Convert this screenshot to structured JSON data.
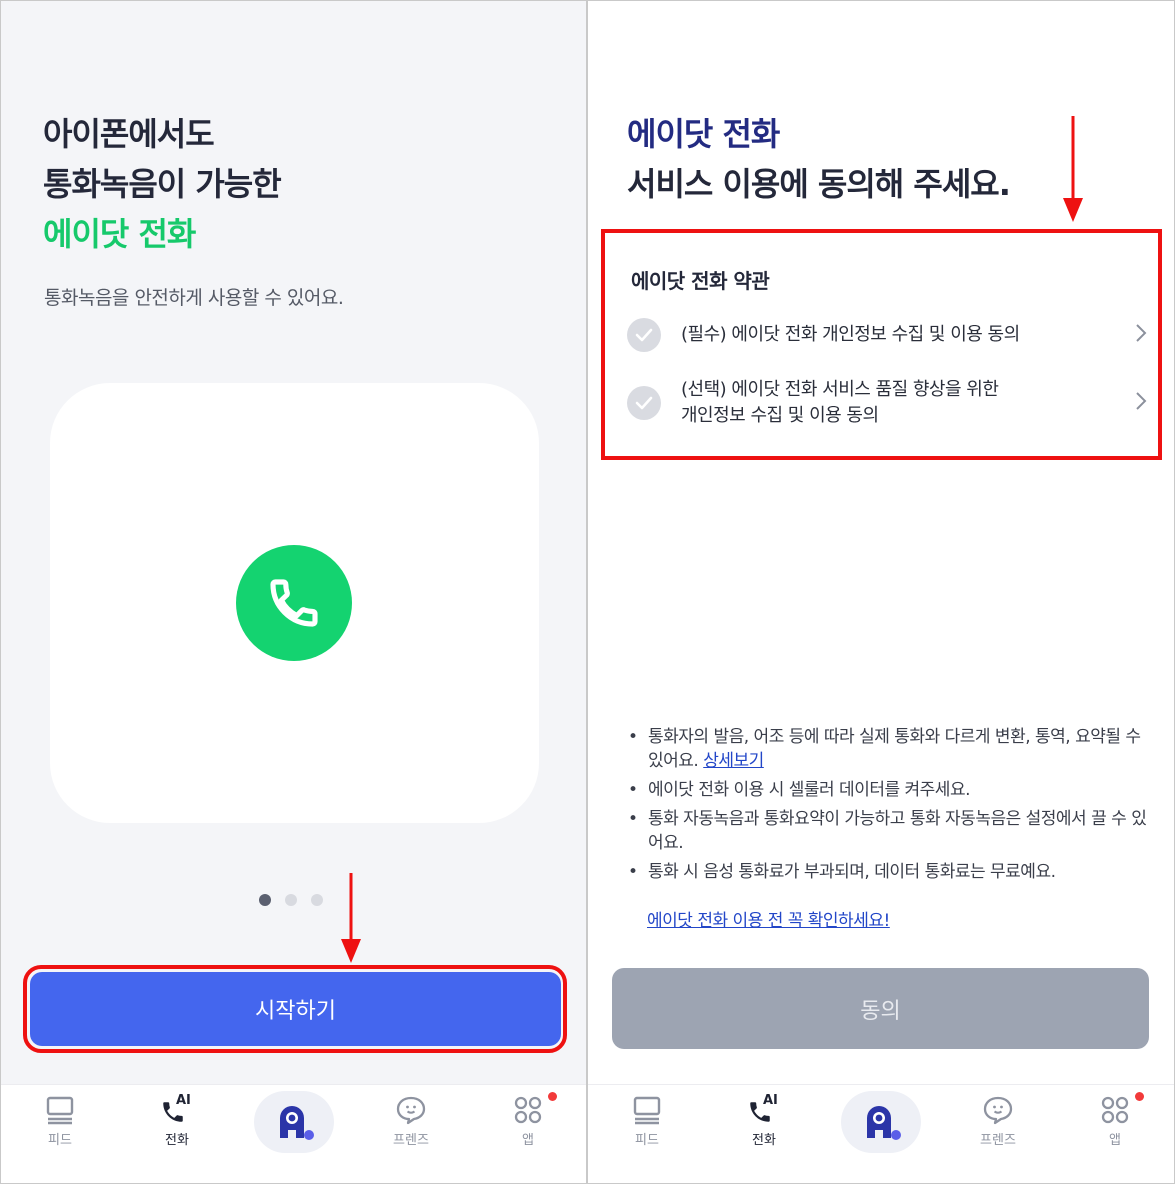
{
  "left": {
    "title_line1": "아이폰에서도",
    "title_line2": "통화녹음이 가능한",
    "title_line3": "에이닷 전화",
    "subtitle": "통화녹음을 안전하게 사용할 수 있어요.",
    "card_icon": "phone-icon",
    "pager": {
      "count": 3,
      "active": 1
    },
    "start_button": "시작하기"
  },
  "right": {
    "title_line1": "에이닷 전화",
    "title_line2": "서비스 이용에 동의해 주세요.",
    "terms": {
      "title": "에이닷 전화 약관",
      "items": [
        {
          "line1": "(필수) 에이닷 전화 개인정보 수집 및 이용 동의",
          "line2": ""
        },
        {
          "line1": "(선택) 에이닷 전화 서비스 품질 향상을 위한",
          "line2": "개인정보 수집 및 이용 동의"
        }
      ]
    },
    "notes": [
      {
        "text": "통화자의 발음, 어조 등에 따라 실제 통화와 다르게 변환, 통역, 요약될 수 있어요. ",
        "link": "상세보기"
      },
      {
        "text": "에이닷 전화 이용 시 셀룰러 데이터를 켜주세요.",
        "link": ""
      },
      {
        "text": "통화 자동녹음과 통화요약이 가능하고 통화 자동녹음은 설정에서 끌 수 있어요.",
        "link": ""
      },
      {
        "text": "통화 시 음성 통화료가 부과되며, 데이터 통화료는 무료예요.",
        "link": ""
      }
    ],
    "notice_link": "에이닷 전화 이용 전 꼭 확인하세요!",
    "agree_button": "동의"
  },
  "nav": {
    "feed": "피드",
    "call": "전화",
    "call_badge": "AI",
    "friends": "프렌즈",
    "apps": "앱"
  },
  "colors": {
    "accent_green": "#16c96b",
    "accent_navy": "#232b82",
    "primary_blue": "#4466ee",
    "disabled_gray": "#9da4b2",
    "highlight_red": "#ee1111"
  }
}
